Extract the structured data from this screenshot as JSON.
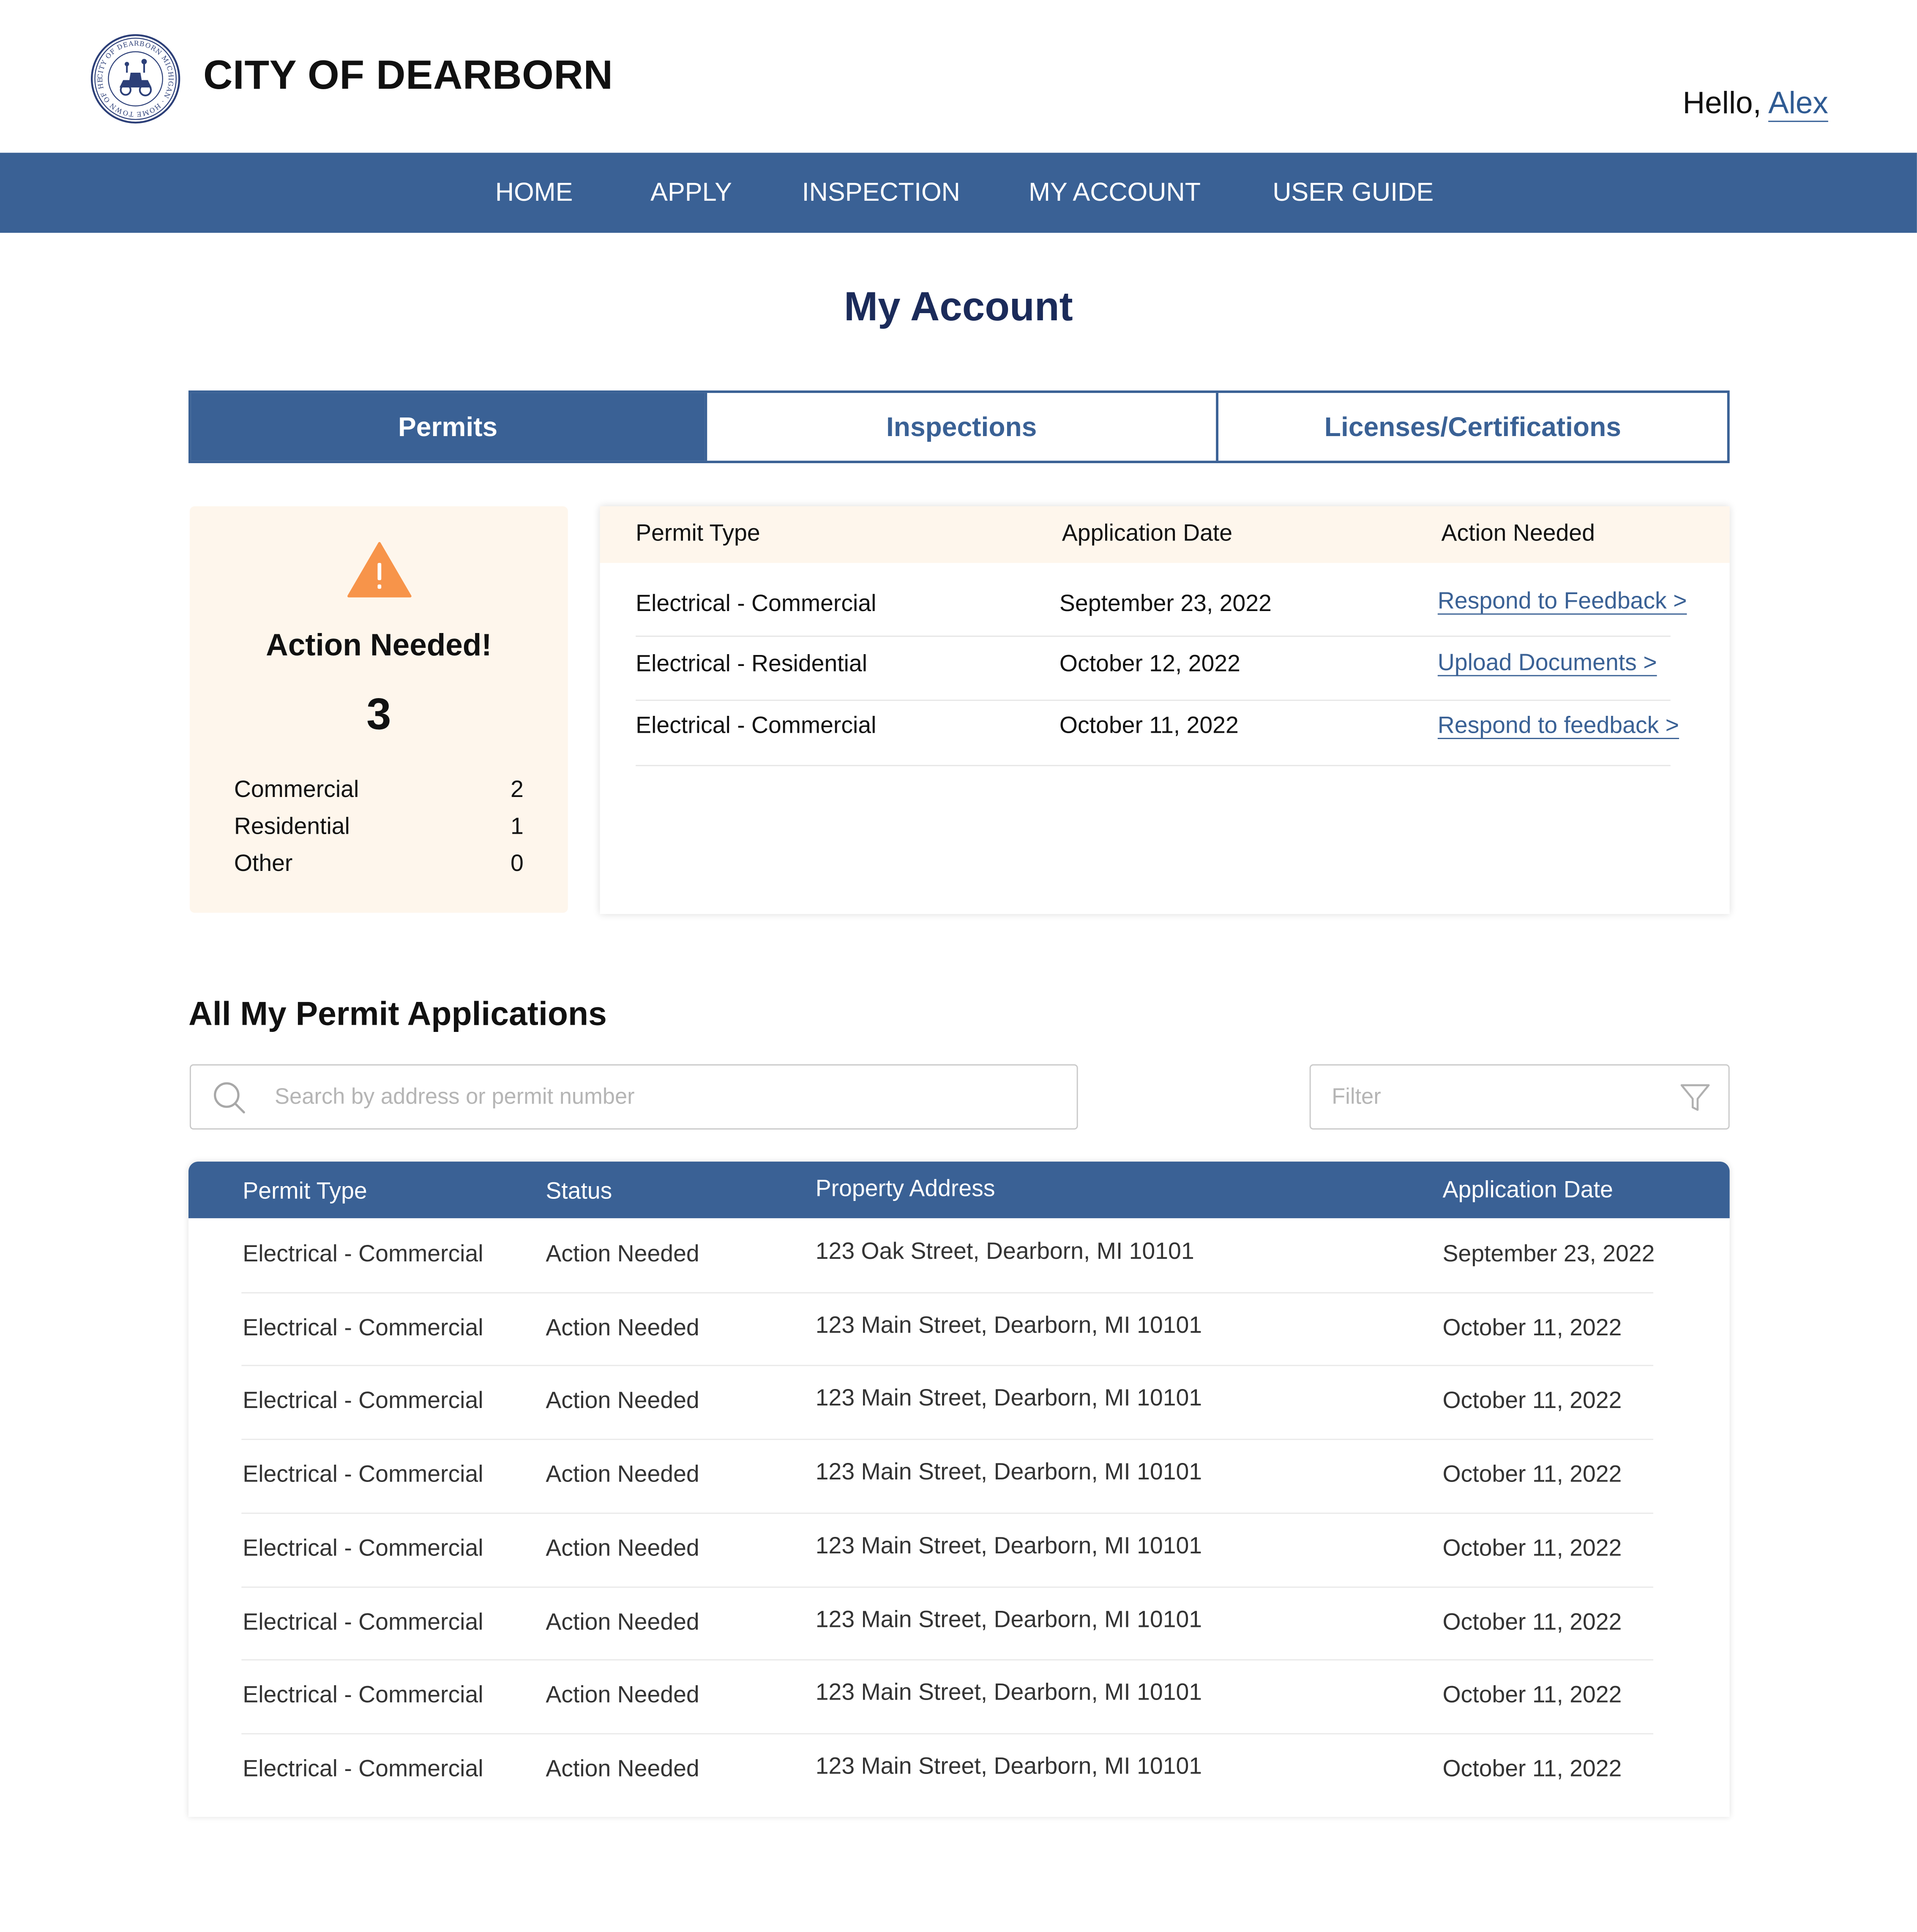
{
  "header": {
    "seal_text": "CITY OF DEARBORN MICHIGAN · HOME TOWN OF HENRY FORD",
    "site_title": "CITY OF DEARBORN",
    "greeting_prefix": "Hello,",
    "user_name": "Alex"
  },
  "nav": {
    "items": [
      "HOME",
      "APPLY",
      "INSPECTION",
      "MY ACCOUNT",
      "USER GUIDE"
    ]
  },
  "page": {
    "title": "My Account"
  },
  "tabs": {
    "items": [
      "Permits",
      "Inspections",
      "Licenses/Certifications"
    ],
    "active": "Permits"
  },
  "action_card": {
    "icon": "warning-icon",
    "title": "Action Needed!",
    "count": "3",
    "breakdown": [
      {
        "label": "Commercial",
        "value": "2"
      },
      {
        "label": "Residential",
        "value": "1"
      },
      {
        "label": "Other",
        "value": "0"
      }
    ]
  },
  "action_table": {
    "headers": [
      "Permit Type",
      "Application Date",
      "Action Needed"
    ],
    "rows": [
      {
        "type": "Electrical - Commercial",
        "date": "September 23, 2022",
        "action": "Respond to Feedback >"
      },
      {
        "type": "Electrical - Residential",
        "date": "October 12, 2022",
        "action": "Upload Documents >"
      },
      {
        "type": "Electrical - Commercial",
        "date": "October 11, 2022",
        "action": "Respond to feedback >"
      }
    ]
  },
  "applications": {
    "title": "All My Permit Applications",
    "search_placeholder": "Search by address or permit number",
    "filter_placeholder": "Filter",
    "headers": [
      "Permit Type",
      "Status",
      "Property Address",
      "Application Date"
    ],
    "rows": [
      {
        "type": "Electrical - Commercial",
        "status": "Action Needed",
        "address": "123 Oak Street, Dearborn, MI 10101",
        "date": "September 23, 2022"
      },
      {
        "type": "Electrical - Commercial",
        "status": "Action Needed",
        "address": "123 Main Street, Dearborn, MI 10101",
        "date": "October 11, 2022"
      },
      {
        "type": "Electrical - Commercial",
        "status": "Action Needed",
        "address": "123 Main Street, Dearborn, MI 10101",
        "date": "October 11, 2022"
      },
      {
        "type": "Electrical - Commercial",
        "status": "Action Needed",
        "address": "123 Main Street, Dearborn, MI 10101",
        "date": "October 11, 2022"
      },
      {
        "type": "Electrical - Commercial",
        "status": "Action Needed",
        "address": "123 Main Street, Dearborn, MI 10101",
        "date": "October 11, 2022"
      },
      {
        "type": "Electrical - Commercial",
        "status": "Action Needed",
        "address": "123 Main Street, Dearborn, MI 10101",
        "date": "October 11, 2022"
      },
      {
        "type": "Electrical - Commercial",
        "status": "Action Needed",
        "address": "123 Main Street, Dearborn, MI 10101",
        "date": "October 11, 2022"
      },
      {
        "type": "Electrical - Commercial",
        "status": "Action Needed",
        "address": "123 Main Street, Dearborn, MI 10101",
        "date": "October 11, 2022"
      }
    ]
  },
  "colors": {
    "brand_blue": "#3a6195",
    "title_navy": "#1b2b5a",
    "card_cream": "#fef6ec",
    "warning_orange": "#f7944a"
  }
}
